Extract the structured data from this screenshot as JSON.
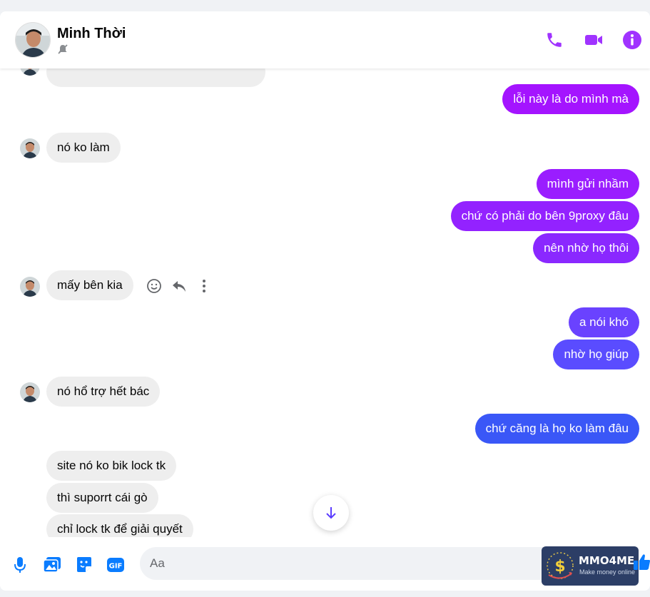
{
  "header": {
    "name": "Minh Thời"
  },
  "messages": {
    "m0": "lỗi này là do mình mà",
    "m1": "nó ko làm",
    "m2": "mình gửi nhầm",
    "m3": "chứ có phải do bên 9proxy đâu",
    "m4": "nên nhờ họ thôi",
    "m5": "mấy bên kia",
    "m6": "a nói khó",
    "m7": "nhờ họ giúp",
    "m8": "nó hổ trợ hết bác",
    "m9": "chứ căng là họ ko làm đâu",
    "m10": "site nó ko bik lock tk",
    "m11": "thì suporrt cái gò",
    "m12": "chỉ lock tk để giải quyết"
  },
  "composer": {
    "placeholder": "Aa",
    "gif_label": "GIF"
  },
  "watermark": {
    "brand": "MMO4ME",
    "tagline": "Make money online"
  },
  "colors": {
    "accent": "#a033ff",
    "out_gradient": [
      "#a414ff",
      "#8f26ff",
      "#7a3cff",
      "#5c4cff",
      "#3f5cff",
      "#2e60f0"
    ],
    "in_bubble": "#eeeeee"
  }
}
